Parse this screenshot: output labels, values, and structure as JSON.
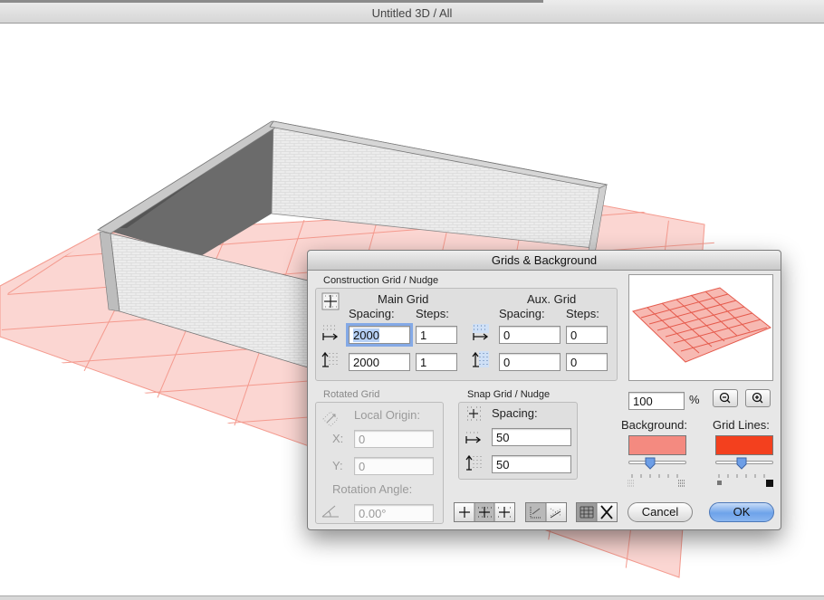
{
  "window": {
    "title": "Untitled 3D / All"
  },
  "dialog": {
    "title": "Grids & Background",
    "construction": {
      "label": "Construction Grid / Nudge",
      "main_grid_label": "Main Grid",
      "aux_grid_label": "Aux. Grid",
      "spacing_label": "Spacing:",
      "steps_label": "Steps:",
      "main_x_spacing": "2000",
      "main_x_steps": "1",
      "main_y_spacing": "2000",
      "main_y_steps": "1",
      "aux_x_spacing": "0",
      "aux_x_steps": "0",
      "aux_y_spacing": "0",
      "aux_y_steps": "0"
    },
    "rotated": {
      "label": "Rotated Grid",
      "local_origin_label": "Local Origin:",
      "x_label": "X:",
      "x_value": "0",
      "y_label": "Y:",
      "y_value": "0",
      "angle_label": "Rotation Angle:",
      "angle_value": "0.00°"
    },
    "snap": {
      "label": "Snap Grid / Nudge",
      "spacing_label": "Spacing:",
      "x_spacing": "50",
      "y_spacing": "50"
    },
    "zoom": {
      "value": "100",
      "unit": "%"
    },
    "background": {
      "label": "Background:",
      "color": "#f48a80",
      "slider_value": 0.35
    },
    "grid_lines": {
      "label": "Grid Lines:",
      "color": "#f3401e",
      "slider_value": 0.45
    },
    "cancel_label": "Cancel",
    "ok_label": "OK"
  },
  "icons": {
    "grid": "grid-icon",
    "horizontal_spacing": "horizontal-arrow-icon",
    "vertical_spacing": "vertical-arrow-icon",
    "zoom_out": "zoom-out-icon",
    "zoom_in": "zoom-in-icon"
  }
}
